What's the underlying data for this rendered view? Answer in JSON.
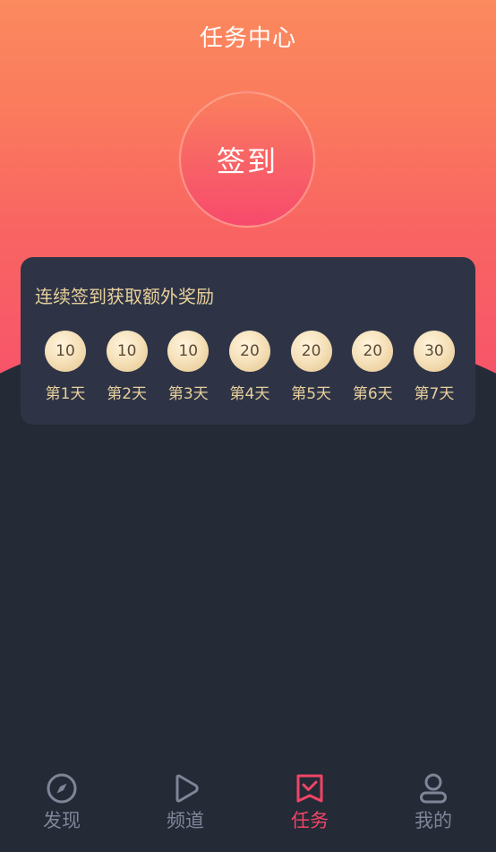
{
  "header": {
    "title": "任务中心"
  },
  "checkin": {
    "label": "签到"
  },
  "reward_card": {
    "title": "连续签到获取额外奖励",
    "days": [
      {
        "points": "10",
        "label": "第1天"
      },
      {
        "points": "10",
        "label": "第2天"
      },
      {
        "points": "10",
        "label": "第3天"
      },
      {
        "points": "20",
        "label": "第4天"
      },
      {
        "points": "20",
        "label": "第5天"
      },
      {
        "points": "20",
        "label": "第6天"
      },
      {
        "points": "30",
        "label": "第7天"
      }
    ]
  },
  "tabbar": {
    "items": [
      {
        "label": "发现",
        "icon": "compass-icon",
        "active": false
      },
      {
        "label": "频道",
        "icon": "play-icon",
        "active": false
      },
      {
        "label": "任务",
        "icon": "task-check-icon",
        "active": true
      },
      {
        "label": "我的",
        "icon": "user-icon",
        "active": false
      }
    ]
  },
  "colors": {
    "accent": "#ef4565",
    "gold": "#e8cf9c",
    "background": "#252a37",
    "card": "#2e3446",
    "inactive": "#7f8597"
  }
}
